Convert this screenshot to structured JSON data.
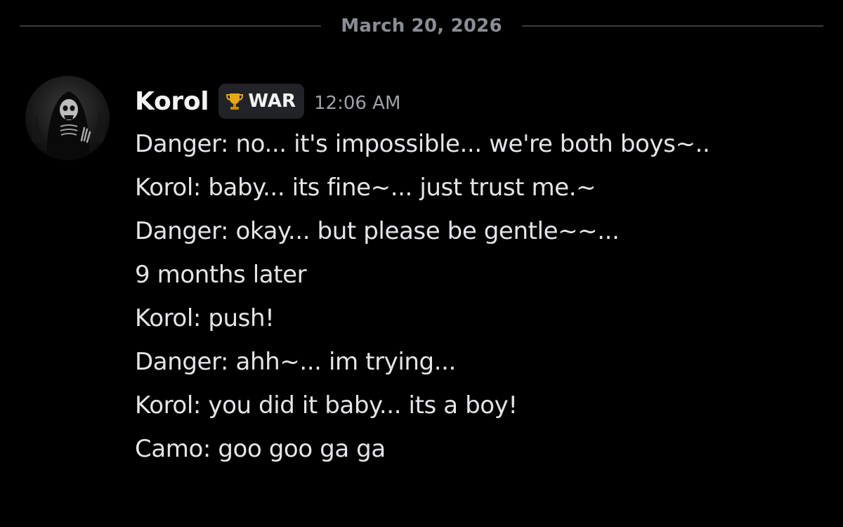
{
  "divider": {
    "date": "March 20, 2026"
  },
  "message": {
    "author": "Korol",
    "tag_icon": "trophy-icon",
    "tag": "WAR",
    "timestamp": "12:06 AM",
    "avatar_icon": "grim-reaper-avatar",
    "lines": [
      "Danger: no... it's impossible... we're both boys~..",
      "Korol: baby... its fine~... just trust me.~",
      "Danger: okay... but please be gentle~~...",
      "9 months later",
      "Korol: push!",
      "Danger: ahh~... im trying...",
      "Korol: you did it baby... its a boy!",
      "Camo: goo goo ga ga"
    ]
  },
  "colors": {
    "background": "#000000",
    "text": "#e3e5e8",
    "muted": "#9ea1a8",
    "divider": "#3a3c42",
    "tag_bg": "#222327",
    "trophy": "#e6a817"
  }
}
